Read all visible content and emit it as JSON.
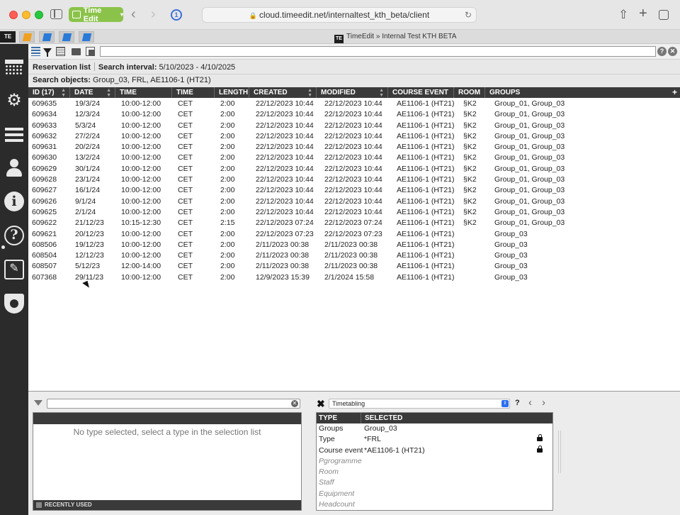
{
  "browser": {
    "tab_group_label": "Time Edit",
    "url": "cloud.timeedit.net/internaltest_kth_beta/client",
    "tab_title": "TimeEdit » Internal Test KTH BETA",
    "te_badge": "TE"
  },
  "header": {
    "reservation_list_label": "Reservation list",
    "search_interval_label": "Search interval:",
    "search_interval_value": "5/10/2023 - 4/10/2025",
    "search_objects_label": "Search objects:",
    "search_objects_value": "Group_03, FRL, AE1106-1 (HT21)"
  },
  "grid": {
    "columns": [
      "ID (17)",
      "DATE",
      "TIME",
      "TIME ZONE",
      "LENGTH",
      "CREATED",
      "MODIFIED",
      "COURSE EVENT",
      "ROOM",
      "GROUPS"
    ],
    "add_column": "+",
    "rows": [
      [
        "609635",
        "19/3/24",
        "10:00-12:00",
        "CET",
        "2:00",
        "22/12/2023 10:44",
        "22/12/2023 10:44",
        "AE1106-1 (HT21)",
        "§K2",
        "Group_01, Group_03"
      ],
      [
        "609634",
        "12/3/24",
        "10:00-12:00",
        "CET",
        "2:00",
        "22/12/2023 10:44",
        "22/12/2023 10:44",
        "AE1106-1 (HT21)",
        "§K2",
        "Group_01, Group_03"
      ],
      [
        "609633",
        "5/3/24",
        "10:00-12:00",
        "CET",
        "2:00",
        "22/12/2023 10:44",
        "22/12/2023 10:44",
        "AE1106-1 (HT21)",
        "§K2",
        "Group_01, Group_03"
      ],
      [
        "609632",
        "27/2/24",
        "10:00-12:00",
        "CET",
        "2:00",
        "22/12/2023 10:44",
        "22/12/2023 10:44",
        "AE1106-1 (HT21)",
        "§K2",
        "Group_01, Group_03"
      ],
      [
        "609631",
        "20/2/24",
        "10:00-12:00",
        "CET",
        "2:00",
        "22/12/2023 10:44",
        "22/12/2023 10:44",
        "AE1106-1 (HT21)",
        "§K2",
        "Group_01, Group_03"
      ],
      [
        "609630",
        "13/2/24",
        "10:00-12:00",
        "CET",
        "2:00",
        "22/12/2023 10:44",
        "22/12/2023 10:44",
        "AE1106-1 (HT21)",
        "§K2",
        "Group_01, Group_03"
      ],
      [
        "609629",
        "30/1/24",
        "10:00-12:00",
        "CET",
        "2:00",
        "22/12/2023 10:44",
        "22/12/2023 10:44",
        "AE1106-1 (HT21)",
        "§K2",
        "Group_01, Group_03"
      ],
      [
        "609628",
        "23/1/24",
        "10:00-12:00",
        "CET",
        "2:00",
        "22/12/2023 10:44",
        "22/12/2023 10:44",
        "AE1106-1 (HT21)",
        "§K2",
        "Group_01, Group_03"
      ],
      [
        "609627",
        "16/1/24",
        "10:00-12:00",
        "CET",
        "2:00",
        "22/12/2023 10:44",
        "22/12/2023 10:44",
        "AE1106-1 (HT21)",
        "§K2",
        "Group_01, Group_03"
      ],
      [
        "609626",
        "9/1/24",
        "10:00-12:00",
        "CET",
        "2:00",
        "22/12/2023 10:44",
        "22/12/2023 10:44",
        "AE1106-1 (HT21)",
        "§K2",
        "Group_01, Group_03"
      ],
      [
        "609625",
        "2/1/24",
        "10:00-12:00",
        "CET",
        "2:00",
        "22/12/2023 10:44",
        "22/12/2023 10:44",
        "AE1106-1 (HT21)",
        "§K2",
        "Group_01, Group_03"
      ],
      [
        "609622",
        "21/12/23",
        "10:15-12:30",
        "CET",
        "2:15",
        "22/12/2023 07:24",
        "22/12/2023 07:24",
        "AE1106-1 (HT21)",
        "§K2",
        "Group_01, Group_03"
      ],
      [
        "609621",
        "20/12/23",
        "10:00-12:00",
        "CET",
        "2:00",
        "22/12/2023 07:23",
        "22/12/2023 07:23",
        "AE1106-1 (HT21)",
        "",
        "Group_03"
      ],
      [
        "608506",
        "19/12/23",
        "10:00-12:00",
        "CET",
        "2:00",
        "2/11/2023 00:38",
        "2/11/2023 00:38",
        "AE1106-1 (HT21)",
        "",
        "Group_03"
      ],
      [
        "608504",
        "12/12/23",
        "10:00-12:00",
        "CET",
        "2:00",
        "2/11/2023 00:38",
        "2/11/2023 00:38",
        "AE1106-1 (HT21)",
        "",
        "Group_03"
      ],
      [
        "608507",
        "5/12/23",
        "12:00-14:00",
        "CET",
        "2:00",
        "2/11/2023 00:38",
        "2/11/2023 00:38",
        "AE1106-1 (HT21)",
        "",
        "Group_03"
      ],
      [
        "607368",
        "29/11/23",
        "10:00-12:00",
        "CET",
        "2:00",
        "12/9/2023 15:39",
        "2/1/2024 15:58",
        "AE1106-1 (HT21)",
        "",
        "Group_03"
      ]
    ]
  },
  "type_panel": {
    "empty_message": "No type selected, select a type in the selection list",
    "recently_used_label": "RECENTLY USED"
  },
  "selection_panel": {
    "dropdown_value": "Timetabling",
    "help": "?",
    "header_type": "TYPE",
    "header_selected": "SELECTED",
    "rows": [
      {
        "type": "Groups",
        "selected": "Group_03",
        "locked": false,
        "muted": false
      },
      {
        "type": "Type",
        "selected": "*FRL",
        "locked": true,
        "muted": false
      },
      {
        "type": "Course event",
        "selected": "*AE1106-1 (HT21)",
        "locked": true,
        "muted": false
      },
      {
        "type": "Pgrogramme",
        "selected": "",
        "locked": false,
        "muted": true
      },
      {
        "type": "Room",
        "selected": "",
        "locked": false,
        "muted": true
      },
      {
        "type": "Staff",
        "selected": "",
        "locked": false,
        "muted": true
      },
      {
        "type": "Equipment",
        "selected": "",
        "locked": false,
        "muted": true
      },
      {
        "type": "Headcount",
        "selected": "",
        "locked": false,
        "muted": true
      }
    ]
  },
  "colors": {
    "tab_group": "#8bc34a",
    "grid_header": "#3a3a3a",
    "app_nav": "#2b2b2b"
  }
}
